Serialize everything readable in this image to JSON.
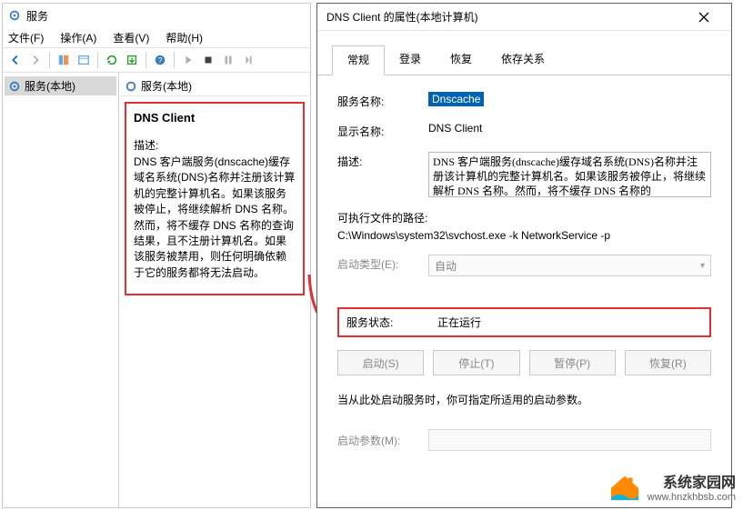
{
  "services_window": {
    "title": "服务",
    "menus": {
      "file": "文件(F)",
      "action": "操作(A)",
      "view": "查看(V)",
      "help": "帮助(H)"
    },
    "tree_root": "服务(本地)",
    "detail_heading": "服务(本地)",
    "selected_service": {
      "name": "DNS Client",
      "description_label": "描述:",
      "description": "DNS 客户端服务(dnscache)缓存域名系统(DNS)名称并注册该计算机的完整计算机名。如果该服务被停止，将继续解析 DNS 名称。然而，将不缓存 DNS 名称的查询结果，且不注册计算机名。如果该服务被禁用，则任何明确依赖于它的服务都将无法启动。"
    }
  },
  "properties_dialog": {
    "title": "DNS Client 的属性(本地计算机)",
    "tabs": {
      "general": "常规",
      "logon": "登录",
      "recovery": "恢复",
      "dependencies": "依存关系"
    },
    "fields": {
      "service_name_label": "服务名称:",
      "service_name_value": "Dnscache",
      "display_name_label": "显示名称:",
      "display_name_value": "DNS Client",
      "description_label": "描述:",
      "description_value": "DNS 客户端服务(dnscache)缓存域名系统(DNS)名称并注册该计算机的完整计算机名。如果该服务被停止，将继续解析 DNS 名称。然而，将不缓存 DNS 名称的",
      "exe_path_label": "可执行文件的路径:",
      "exe_path_value": "C:\\Windows\\system32\\svchost.exe -k NetworkService -p",
      "startup_type_label": "启动类型(E):",
      "startup_type_value": "自动"
    },
    "status": {
      "label": "服务状态:",
      "value": "正在运行",
      "buttons": {
        "start": "启动(S)",
        "stop": "停止(T)",
        "pause": "暂停(P)",
        "resume": "恢复(R)"
      },
      "note": "当从此处启动服务时，你可指定所适用的启动参数。",
      "params_label": "启动参数(M):"
    }
  },
  "watermark": {
    "name": "系统家园网",
    "url": "www.hnzkhbsb.com"
  }
}
